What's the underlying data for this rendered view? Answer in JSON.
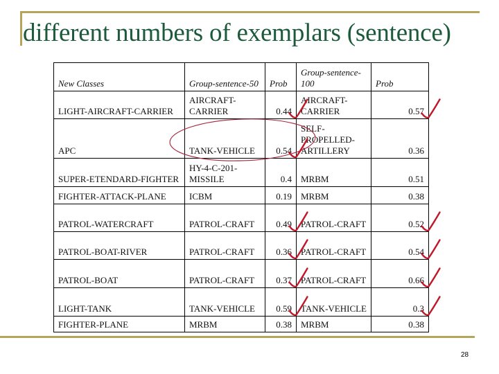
{
  "slide": {
    "title": "different numbers of exemplars (sentence)",
    "page_number": "28",
    "accent_color": "#b5a55a",
    "title_color": "#1d5a3b",
    "annotation_color": "#c0182a"
  },
  "table": {
    "headers": [
      "New Classes",
      "Group-sentence-50",
      "Prob",
      "Group-sentence-100",
      "Prob"
    ],
    "rows": [
      {
        "new_class": "LIGHT-AIRCRAFT-CARRIER",
        "g50": "AIRCRAFT-CARRIER",
        "p50": "0.44",
        "g100": "AIRCRAFT-CARRIER",
        "p100": "0.57",
        "check50": true,
        "check100": true
      },
      {
        "new_class": "APC",
        "g50": "TANK-VEHICLE",
        "p50": "0.54",
        "g100": "SELF-PROPELLED-ARTILLERY",
        "p100": "0.36",
        "check50": true,
        "check100": false,
        "circled50": true
      },
      {
        "new_class": "SUPER-ETENDARD-FIGHTER",
        "g50": "HY-4-C-201-MISSILE",
        "p50": "0.4",
        "g100": "MRBM",
        "p100": "0.51",
        "check50": false,
        "check100": false
      },
      {
        "new_class": "FIGHTER-ATTACK-PLANE",
        "g50": "ICBM",
        "p50": "0.19",
        "g100": "MRBM",
        "p100": "0.38",
        "check50": false,
        "check100": false
      },
      {
        "new_class": "PATROL-WATERCRAFT",
        "g50": "PATROL-CRAFT",
        "p50": "0.49",
        "g100": "PATROL-CRAFT",
        "p100": "0.52",
        "check50": true,
        "check100": true
      },
      {
        "new_class": "PATROL-BOAT-RIVER",
        "g50": "PATROL-CRAFT",
        "p50": "0.36",
        "g100": "PATROL-CRAFT",
        "p100": "0.54",
        "check50": true,
        "check100": true
      },
      {
        "new_class": "PATROL-BOAT",
        "g50": "PATROL-CRAFT",
        "p50": "0.37",
        "g100": "PATROL-CRAFT",
        "p100": "0.66",
        "check50": true,
        "check100": true
      },
      {
        "new_class": "LIGHT-TANK",
        "g50": "TANK-VEHICLE",
        "p50": "0.59",
        "g100": "TANK-VEHICLE",
        "p100": "0.3",
        "check50": true,
        "check100": true
      },
      {
        "new_class": "FIGHTER-PLANE",
        "g50": "MRBM",
        "p50": "0.38",
        "g100": "MRBM",
        "p100": "0.38",
        "check50": false,
        "check100": false
      }
    ]
  }
}
